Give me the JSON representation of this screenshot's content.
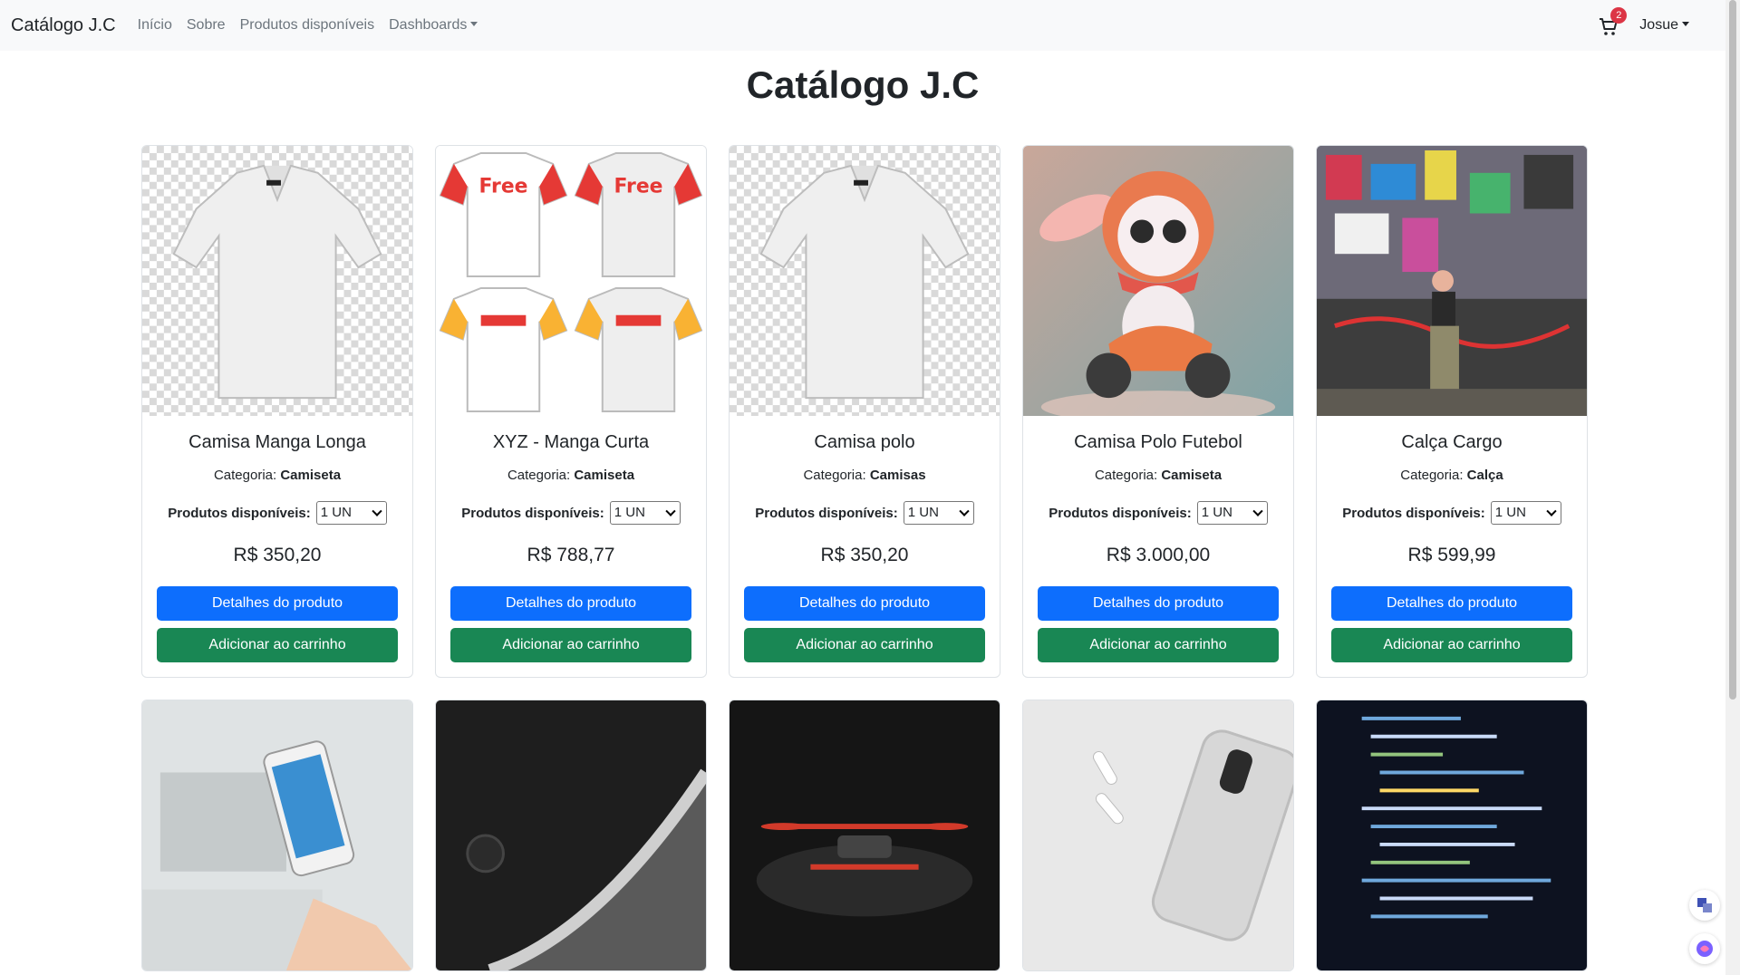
{
  "navbar": {
    "brand": "Catálogo J.C",
    "links": [
      "Início",
      "Sobre",
      "Produtos disponíveis",
      "Dashboards"
    ],
    "cart_count": "2",
    "user": "Josue"
  },
  "page": {
    "title": "Catálogo J.C"
  },
  "labels": {
    "category_prefix": "Categoria:",
    "available": "Produtos disponíveis:",
    "details_button": "Detalhes do produto",
    "add_to_cart_button": "Adicionar ao carrinho"
  },
  "products": [
    {
      "name": "Camisa Manga Longa",
      "category": "Camiseta",
      "qty": "1 UN",
      "price": "R$ 350,20",
      "image": "white-polo-shirt"
    },
    {
      "name": "XYZ - Manga Curta",
      "category": "Camiseta",
      "qty": "1 UN",
      "price": "R$ 788,77",
      "image": "printed-tshirts"
    },
    {
      "name": "Camisa polo",
      "category": "Camisas",
      "qty": "1 UN",
      "price": "R$ 350,20",
      "image": "white-polo-shirt"
    },
    {
      "name": "Camisa Polo Futebol",
      "category": "Camiseta",
      "qty": "1 UN",
      "price": "R$ 3.000,00",
      "image": "bunny-on-scooter"
    },
    {
      "name": "Calça Cargo",
      "category": "Calça",
      "qty": "1 UN",
      "price": "R$ 599,99",
      "image": "cargo-pants-graffiti"
    }
  ],
  "second_row_images": [
    "hand-holding-phone",
    "phone-closeup",
    "red-drone",
    "iphone-airpods",
    "code-screen"
  ],
  "colors": {
    "primary": "#0d6efd",
    "success": "#198754",
    "navbar_bg": "#f8f9fa",
    "badge": "#dc3545"
  }
}
